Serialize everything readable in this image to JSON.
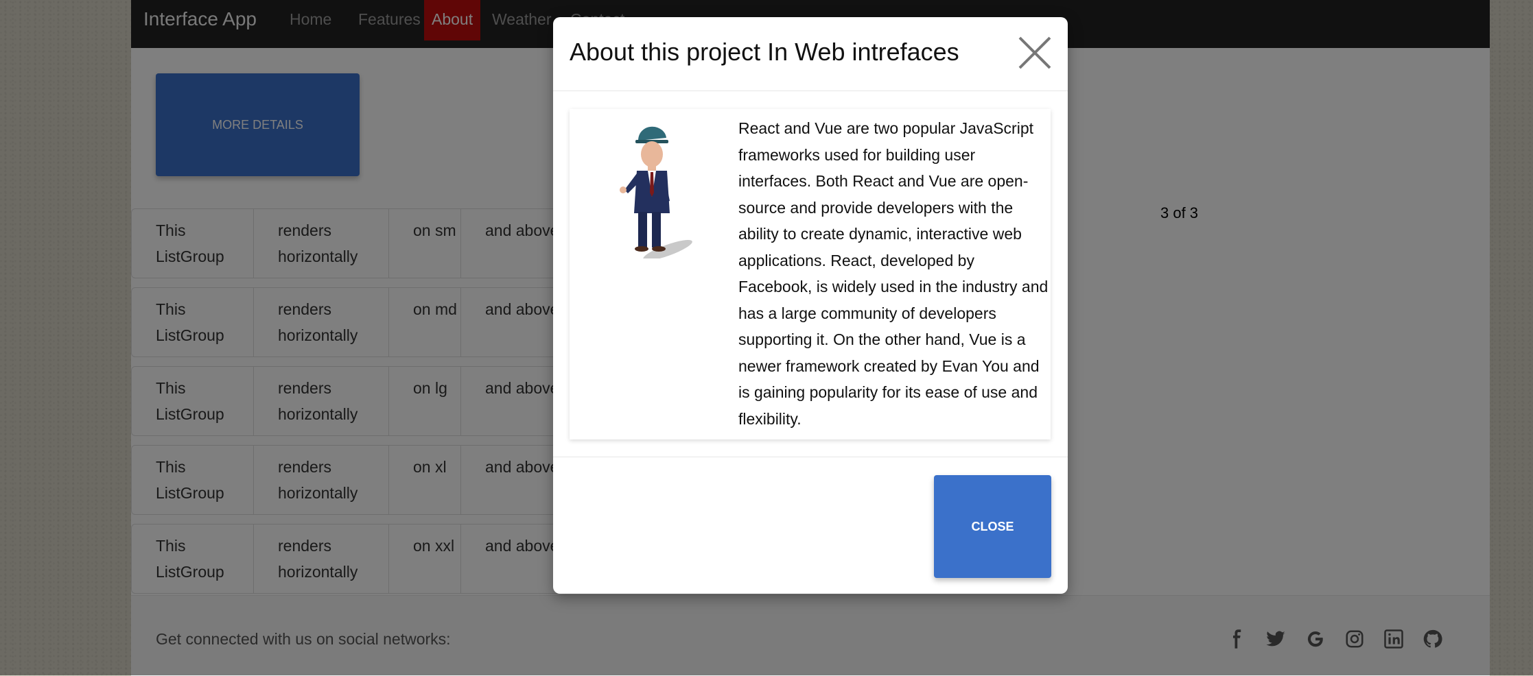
{
  "navbar": {
    "brand": "Interface App",
    "items": [
      {
        "label": "Home"
      },
      {
        "label": "Features"
      },
      {
        "label": "About",
        "active": true
      },
      {
        "label": "Weather"
      },
      {
        "label": "Contact"
      }
    ]
  },
  "main": {
    "details_button": "MORE DETAILS",
    "page_indicator": "3 of 3",
    "list_groups": [
      {
        "cells": [
          "This ListGroup",
          "renders horizontally",
          "on sm",
          "and above!"
        ]
      },
      {
        "cells": [
          "This ListGroup",
          "renders horizontally",
          "on md",
          "and above!"
        ]
      },
      {
        "cells": [
          "This ListGroup",
          "renders horizontally",
          "on lg",
          "and above!"
        ]
      },
      {
        "cells": [
          "This ListGroup",
          "renders horizontally",
          "on xl",
          "and above!"
        ]
      },
      {
        "cells": [
          "This ListGroup",
          "renders horizontally",
          "on xxl",
          "and above!"
        ]
      }
    ]
  },
  "footer": {
    "text": "Get connected with us on social networks:",
    "icons": [
      "facebook-icon",
      "twitter-icon",
      "google-icon",
      "instagram-icon",
      "linkedin-icon",
      "github-icon"
    ]
  },
  "modal": {
    "title": "About this project In Web intrefaces",
    "body": "React and Vue are two popular JavaScript frameworks used for building user interfaces. Both React and Vue are open-source and provide developers with the ability to create dynamic, interactive web applications. React, developed by Facebook, is widely used in the industry and has a large community of developers supporting it. On the other hand, Vue is a newer framework created by Evan You and is gaining popularity for its ease of use and flexibility.",
    "close_label": "CLOSE"
  },
  "colors": {
    "navbar": "#222222",
    "active_nav": "#c00d0d",
    "button": "#3b71ca"
  }
}
